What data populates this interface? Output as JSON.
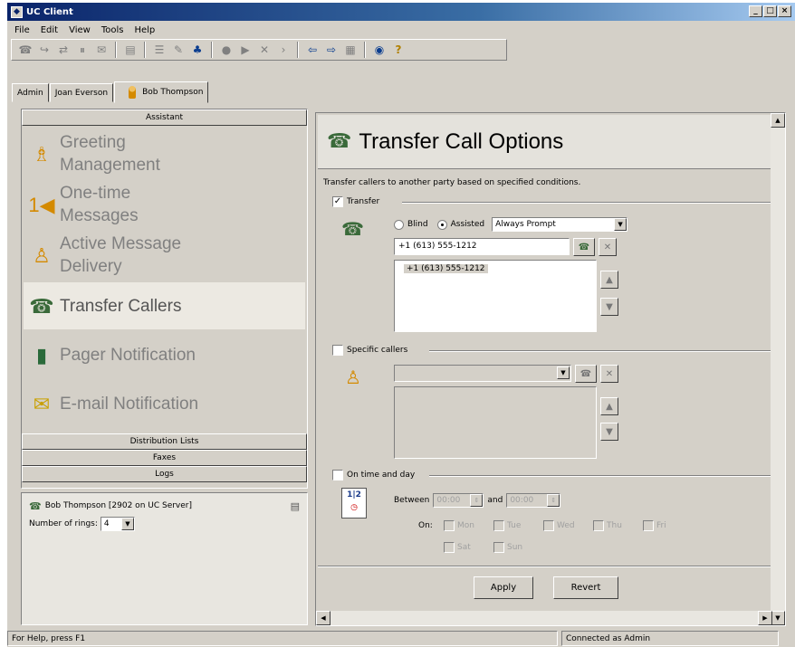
{
  "window": {
    "title": "UC Client",
    "app_icon": "app-icon",
    "controls": [
      "_",
      "□",
      "×"
    ]
  },
  "menu": [
    "File",
    "Edit",
    "View",
    "Tools",
    "Help"
  ],
  "toolbar_icons": [
    "phone-icon",
    "forward-icon",
    "transfer-icon",
    "hold-icon",
    "voicemail-icon",
    "folder-icon",
    "list-icon",
    "edit-icon",
    "people-icon",
    "record-icon",
    "play-icon",
    "delete-icon",
    "next-icon",
    "back-icon",
    "forward-arrow-icon",
    "doc-icon",
    "globe-icon",
    "help-icon"
  ],
  "user_tabs": [
    "Admin",
    "Joan Everson",
    "Bob Thompson"
  ],
  "sections": {
    "assistant": "Assistant",
    "distribution": "Distribution Lists",
    "faxes": "Faxes",
    "logs": "Logs"
  },
  "nav": [
    {
      "line1": "Greeting",
      "line2": "Management",
      "icon": "greeting-icon"
    },
    {
      "line1": "One-time",
      "line2": "Messages",
      "icon": "one-time-icon"
    },
    {
      "line1": "Active Message",
      "line2": "Delivery",
      "icon": "delivery-icon"
    },
    {
      "line1": "Transfer Callers",
      "line2": "",
      "icon": "transfer-callers-icon"
    },
    {
      "line1": "Pager Notification",
      "line2": "",
      "icon": "pager-icon"
    },
    {
      "line1": "E-mail Notification",
      "line2": "",
      "icon": "email-icon"
    }
  ],
  "info": {
    "user": "Bob Thompson [2902 on UC Server]",
    "rings_label": "Number of rings:",
    "rings_value": "4"
  },
  "panel": {
    "title": "Transfer Call Options",
    "description": "Transfer callers to another party based on specified conditions.",
    "transfer_label": "Transfer",
    "transfer_checked": true,
    "blind_label": "Blind",
    "assisted_label": "Assisted",
    "prompt_value": "Always Prompt",
    "number_input": "+1 (613) 555-1212",
    "number_list": [
      "+1 (613) 555-1212"
    ],
    "specific_label": "Specific callers",
    "specific_checked": false,
    "time_label": "On time and day",
    "time_checked": false,
    "between_label": "Between",
    "time_from": "00:00",
    "and_label": "and",
    "time_to": "00:00",
    "on_label": "On:",
    "days": [
      "Mon",
      "Tue",
      "Wed",
      "Thu",
      "Fri",
      "Sat",
      "Sun"
    ],
    "apply_label": "Apply",
    "revert_label": "Revert"
  },
  "status": {
    "help": "For Help, press F1",
    "connection": "Connected as Admin"
  },
  "colors": {
    "title_bar": "#0a246a",
    "face": "#d4d0c8",
    "selected_nav": "#ece9e2"
  }
}
